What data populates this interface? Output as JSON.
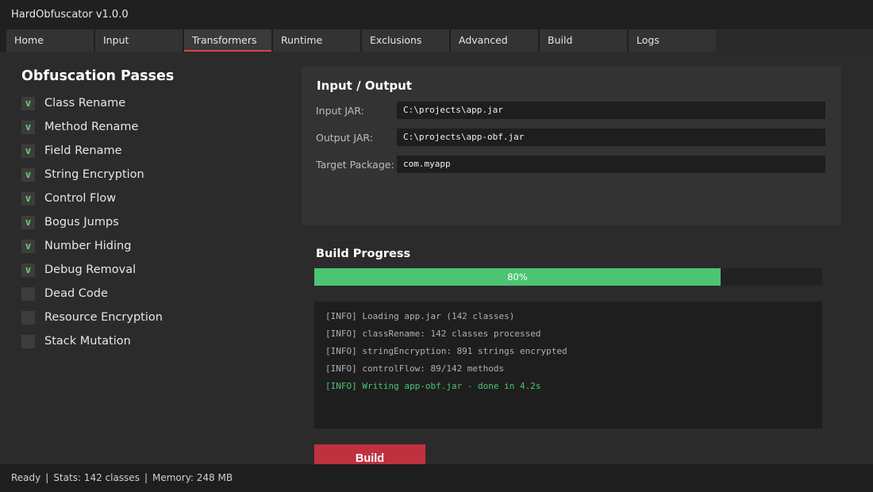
{
  "window": {
    "title": "HardObfuscator v1.0.0"
  },
  "tabs": [
    {
      "label": "Home"
    },
    {
      "label": "Input"
    },
    {
      "label": "Transformers",
      "active": true
    },
    {
      "label": "Runtime"
    },
    {
      "label": "Exclusions"
    },
    {
      "label": "Advanced"
    },
    {
      "label": "Build"
    },
    {
      "label": "Logs"
    }
  ],
  "passes": {
    "title": "Obfuscation Passes",
    "items": [
      {
        "label": "Class Rename",
        "checked": true,
        "mark": "v"
      },
      {
        "label": "Method Rename",
        "checked": true,
        "mark": "v"
      },
      {
        "label": "Field Rename",
        "checked": true,
        "mark": "v"
      },
      {
        "label": "String Encryption",
        "checked": true,
        "mark": "v"
      },
      {
        "label": "Control Flow",
        "checked": true,
        "mark": "v"
      },
      {
        "label": "Bogus Jumps",
        "checked": true,
        "mark": "v"
      },
      {
        "label": "Number Hiding",
        "checked": true,
        "mark": "v"
      },
      {
        "label": "Debug Removal",
        "checked": true,
        "mark": "v"
      },
      {
        "label": "Dead Code",
        "checked": false,
        "mark": ""
      },
      {
        "label": "Resource Encryption",
        "checked": false,
        "mark": ""
      },
      {
        "label": "Stack Mutation",
        "checked": false,
        "mark": ""
      }
    ]
  },
  "io": {
    "title": "Input / Output",
    "input_label": "Input JAR:",
    "input_value": "C:\\projects\\app.jar",
    "output_label": "Output JAR:",
    "output_value": "C:\\projects\\app-obf.jar",
    "package_label": "Target Package:",
    "package_value": "com.myapp"
  },
  "progress": {
    "title": "Build Progress",
    "percent": 80,
    "text": "80%",
    "fill_color": "#4cc472"
  },
  "log": {
    "lines": [
      {
        "text": "[INFO] Loading app.jar (142 classes)",
        "status": "info"
      },
      {
        "text": "[INFO] classRename: 142 classes processed",
        "status": "info"
      },
      {
        "text": "[INFO] stringEncryption: 891 strings encrypted",
        "status": "info"
      },
      {
        "text": "[INFO] controlFlow: 89/142 methods",
        "status": "info"
      },
      {
        "text": "[INFO] Writing app-obf.jar - done in 4.2s",
        "status": "success"
      }
    ]
  },
  "build_button": {
    "label": "Build",
    "color": "#c0313f"
  },
  "status": {
    "state": "Ready",
    "separator": "|",
    "stats": "Stats: 142 classes",
    "memory": "Memory: 248 MB"
  },
  "colors": {
    "accent": "#d64545",
    "success": "#4cc472",
    "check": "#6cd07a"
  }
}
